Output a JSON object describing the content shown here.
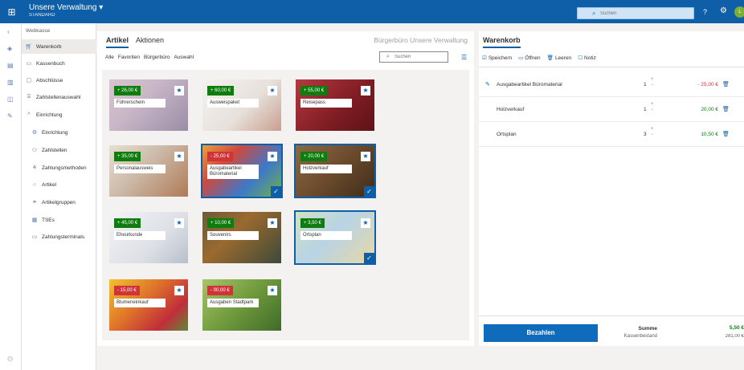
{
  "header": {
    "app_name": "Unsere Verwaltung",
    "dropdown_glyph": "▾",
    "app_subtitle": "STANDARD",
    "search_placeholder": "Suchen",
    "help_glyph": "?",
    "avatar_initial": "L"
  },
  "nav": {
    "heading": "Webkasse",
    "items": [
      {
        "label": "Warenkorb",
        "icon": "cart-icon",
        "active": true
      },
      {
        "label": "Kassenbuch",
        "icon": "book-icon"
      },
      {
        "label": "Abschlüsse",
        "icon": "calendar-icon"
      },
      {
        "label": "Zahlstellenauswahl",
        "icon": "cash-register-icon"
      }
    ],
    "group_label": "Einrichtung",
    "sub_items": [
      {
        "label": "Einrichtung",
        "icon": "gear-icon"
      },
      {
        "label": "Zahlstellen",
        "icon": "people-icon"
      },
      {
        "label": "Zahlungsmethoden",
        "icon": "payment-icon"
      },
      {
        "label": "Artikel",
        "icon": "article-icon"
      },
      {
        "label": "Artikelgruppen",
        "icon": "group-icon"
      },
      {
        "label": "TSEs",
        "icon": "tse-icon"
      },
      {
        "label": "Zahlungsterminals",
        "icon": "terminal-icon"
      }
    ]
  },
  "products": {
    "tabs": [
      "Artikel",
      "Aktionen"
    ],
    "store_name": "Bürgerbüro Unsere Verwaltung",
    "filters": [
      "Alle",
      "Favoriten",
      "Bürgerbüro",
      "Auswahl"
    ],
    "search_placeholder": "Suchen",
    "tiles": [
      {
        "name": "Führerschein",
        "price": "+ 26,00 €",
        "price_kind": "green",
        "selected": false,
        "bg": "linear-gradient(135deg,#d6c4cf 0%,#c9b7c7 40%,#9b8da8 100%)"
      },
      {
        "name": "Ausweispaket",
        "price": "+ 60,00 €",
        "price_kind": "green",
        "selected": false,
        "bg": "linear-gradient(135deg,#f4f2ef 0%,#e7e1dc 55%,#c99f8f 100%)"
      },
      {
        "name": "Reisepass",
        "price": "+ 55,00 €",
        "price_kind": "green",
        "selected": false,
        "bg": "linear-gradient(135deg,#b33a3f 0%,#7e1c23 60%,#5d1217 100%)"
      },
      {
        "name": "Personalausweis",
        "price": "+ 35,00 €",
        "price_kind": "green",
        "selected": false,
        "bg": "linear-gradient(135deg,#e7dfd3 0%,#cbb8a6 45%,#b07a55 100%)"
      },
      {
        "name": "Ausgabeartikel Büromaterial",
        "price": "- 25,00 €",
        "price_kind": "red",
        "selected": true,
        "bg": "linear-gradient(135deg,#e8a23b 0%,#d04a3d 30%,#3d78c9 65%,#6fb24a 100%)"
      },
      {
        "name": "Holzverkauf",
        "price": "+ 20,00 €",
        "price_kind": "green",
        "selected": true,
        "bg": "linear-gradient(135deg,#8a6a44 0%,#6b4b2c 50%,#3f2c19 100%)"
      },
      {
        "name": "Ehеurkunde",
        "price": "+ 45,00 €",
        "price_kind": "green",
        "selected": false,
        "bg": "linear-gradient(135deg,#f2f3f5 0%,#dde0e6 60%,#b8bfcc 100%)"
      },
      {
        "name": "Souvenirs",
        "price": "+ 10,00 €",
        "price_kind": "green",
        "selected": false,
        "bg": "linear-gradient(135deg,#6b5a3a 0%,#9a6a2f 40%,#3d4a3a 100%)"
      },
      {
        "name": "Ortsplan",
        "price": "+ 3,50 €",
        "price_kind": "green",
        "selected": true,
        "bg": "linear-gradient(135deg,#cfe2c4 0%,#b8d3e5 45%,#e8d8a4 100%)"
      },
      {
        "name": "Blumeneinkauf",
        "price": "- 15,00 €",
        "price_kind": "red",
        "selected": false,
        "bg": "linear-gradient(135deg,#f2c12e 0%,#e0752a 40%,#c02e3a 75%,#5d8a35 100%)"
      },
      {
        "name": "Ausgaben Stadtpark",
        "price": "- 00,00 €",
        "price_kind": "red",
        "selected": false,
        "bg": "linear-gradient(135deg,#a7c46a 0%,#6f9a3c 50%,#3f6b2a 100%)"
      }
    ]
  },
  "cart": {
    "title": "Warenkorb",
    "actions": [
      {
        "label": "Speichern",
        "icon": "save-icon"
      },
      {
        "label": "Öffnen",
        "icon": "folder-icon"
      },
      {
        "label": "Leeren",
        "icon": "trash-icon"
      },
      {
        "label": "Notiz",
        "icon": "note-icon"
      }
    ],
    "rows": [
      {
        "name": "Ausgabeartikel Büromaterial",
        "qty": "1",
        "amount": "- 25,00 €",
        "kind": "neg",
        "editable": true
      },
      {
        "name": "Holzverkauf",
        "qty": "1",
        "amount": "20,00 €",
        "kind": "pos",
        "editable": false
      },
      {
        "name": "Ortsplan",
        "qty": "3",
        "amount": "10,50 €",
        "kind": "pos",
        "editable": false
      }
    ],
    "pay_label": "Bezahlen",
    "sum_label": "Summe",
    "balance_label": "Kassenbestand",
    "sum_value": "5,50 €",
    "balance_value": "281,00 €"
  }
}
